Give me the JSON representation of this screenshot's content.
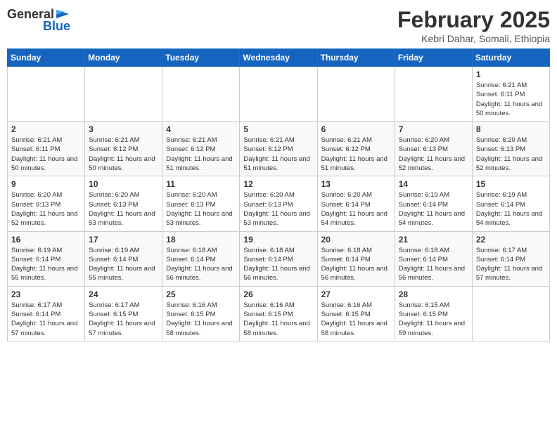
{
  "header": {
    "logo_general": "General",
    "logo_blue": "Blue",
    "month_year": "February 2025",
    "location": "Kebri Dahar, Somali, Ethiopia"
  },
  "days_of_week": [
    "Sunday",
    "Monday",
    "Tuesday",
    "Wednesday",
    "Thursday",
    "Friday",
    "Saturday"
  ],
  "weeks": [
    {
      "days": [
        {
          "num": "",
          "info": ""
        },
        {
          "num": "",
          "info": ""
        },
        {
          "num": "",
          "info": ""
        },
        {
          "num": "",
          "info": ""
        },
        {
          "num": "",
          "info": ""
        },
        {
          "num": "",
          "info": ""
        },
        {
          "num": "1",
          "info": "Sunrise: 6:21 AM\nSunset: 6:11 PM\nDaylight: 11 hours and 50 minutes."
        }
      ]
    },
    {
      "days": [
        {
          "num": "2",
          "info": "Sunrise: 6:21 AM\nSunset: 6:11 PM\nDaylight: 11 hours and 50 minutes."
        },
        {
          "num": "3",
          "info": "Sunrise: 6:21 AM\nSunset: 6:12 PM\nDaylight: 11 hours and 50 minutes."
        },
        {
          "num": "4",
          "info": "Sunrise: 6:21 AM\nSunset: 6:12 PM\nDaylight: 11 hours and 51 minutes."
        },
        {
          "num": "5",
          "info": "Sunrise: 6:21 AM\nSunset: 6:12 PM\nDaylight: 11 hours and 51 minutes."
        },
        {
          "num": "6",
          "info": "Sunrise: 6:21 AM\nSunset: 6:12 PM\nDaylight: 11 hours and 51 minutes."
        },
        {
          "num": "7",
          "info": "Sunrise: 6:20 AM\nSunset: 6:13 PM\nDaylight: 11 hours and 52 minutes."
        },
        {
          "num": "8",
          "info": "Sunrise: 6:20 AM\nSunset: 6:13 PM\nDaylight: 11 hours and 52 minutes."
        }
      ]
    },
    {
      "days": [
        {
          "num": "9",
          "info": "Sunrise: 6:20 AM\nSunset: 6:13 PM\nDaylight: 11 hours and 52 minutes."
        },
        {
          "num": "10",
          "info": "Sunrise: 6:20 AM\nSunset: 6:13 PM\nDaylight: 11 hours and 53 minutes."
        },
        {
          "num": "11",
          "info": "Sunrise: 6:20 AM\nSunset: 6:13 PM\nDaylight: 11 hours and 53 minutes."
        },
        {
          "num": "12",
          "info": "Sunrise: 6:20 AM\nSunset: 6:13 PM\nDaylight: 11 hours and 53 minutes."
        },
        {
          "num": "13",
          "info": "Sunrise: 6:20 AM\nSunset: 6:14 PM\nDaylight: 11 hours and 54 minutes."
        },
        {
          "num": "14",
          "info": "Sunrise: 6:19 AM\nSunset: 6:14 PM\nDaylight: 11 hours and 54 minutes."
        },
        {
          "num": "15",
          "info": "Sunrise: 6:19 AM\nSunset: 6:14 PM\nDaylight: 11 hours and 54 minutes."
        }
      ]
    },
    {
      "days": [
        {
          "num": "16",
          "info": "Sunrise: 6:19 AM\nSunset: 6:14 PM\nDaylight: 11 hours and 55 minutes."
        },
        {
          "num": "17",
          "info": "Sunrise: 6:19 AM\nSunset: 6:14 PM\nDaylight: 11 hours and 55 minutes."
        },
        {
          "num": "18",
          "info": "Sunrise: 6:18 AM\nSunset: 6:14 PM\nDaylight: 11 hours and 56 minutes."
        },
        {
          "num": "19",
          "info": "Sunrise: 6:18 AM\nSunset: 6:14 PM\nDaylight: 11 hours and 56 minutes."
        },
        {
          "num": "20",
          "info": "Sunrise: 6:18 AM\nSunset: 6:14 PM\nDaylight: 11 hours and 56 minutes."
        },
        {
          "num": "21",
          "info": "Sunrise: 6:18 AM\nSunset: 6:14 PM\nDaylight: 11 hours and 56 minutes."
        },
        {
          "num": "22",
          "info": "Sunrise: 6:17 AM\nSunset: 6:14 PM\nDaylight: 11 hours and 57 minutes."
        }
      ]
    },
    {
      "days": [
        {
          "num": "23",
          "info": "Sunrise: 6:17 AM\nSunset: 6:14 PM\nDaylight: 11 hours and 57 minutes."
        },
        {
          "num": "24",
          "info": "Sunrise: 6:17 AM\nSunset: 6:15 PM\nDaylight: 11 hours and 57 minutes."
        },
        {
          "num": "25",
          "info": "Sunrise: 6:16 AM\nSunset: 6:15 PM\nDaylight: 11 hours and 58 minutes."
        },
        {
          "num": "26",
          "info": "Sunrise: 6:16 AM\nSunset: 6:15 PM\nDaylight: 11 hours and 58 minutes."
        },
        {
          "num": "27",
          "info": "Sunrise: 6:16 AM\nSunset: 6:15 PM\nDaylight: 11 hours and 58 minutes."
        },
        {
          "num": "28",
          "info": "Sunrise: 6:15 AM\nSunset: 6:15 PM\nDaylight: 11 hours and 59 minutes."
        },
        {
          "num": "",
          "info": ""
        }
      ]
    }
  ]
}
